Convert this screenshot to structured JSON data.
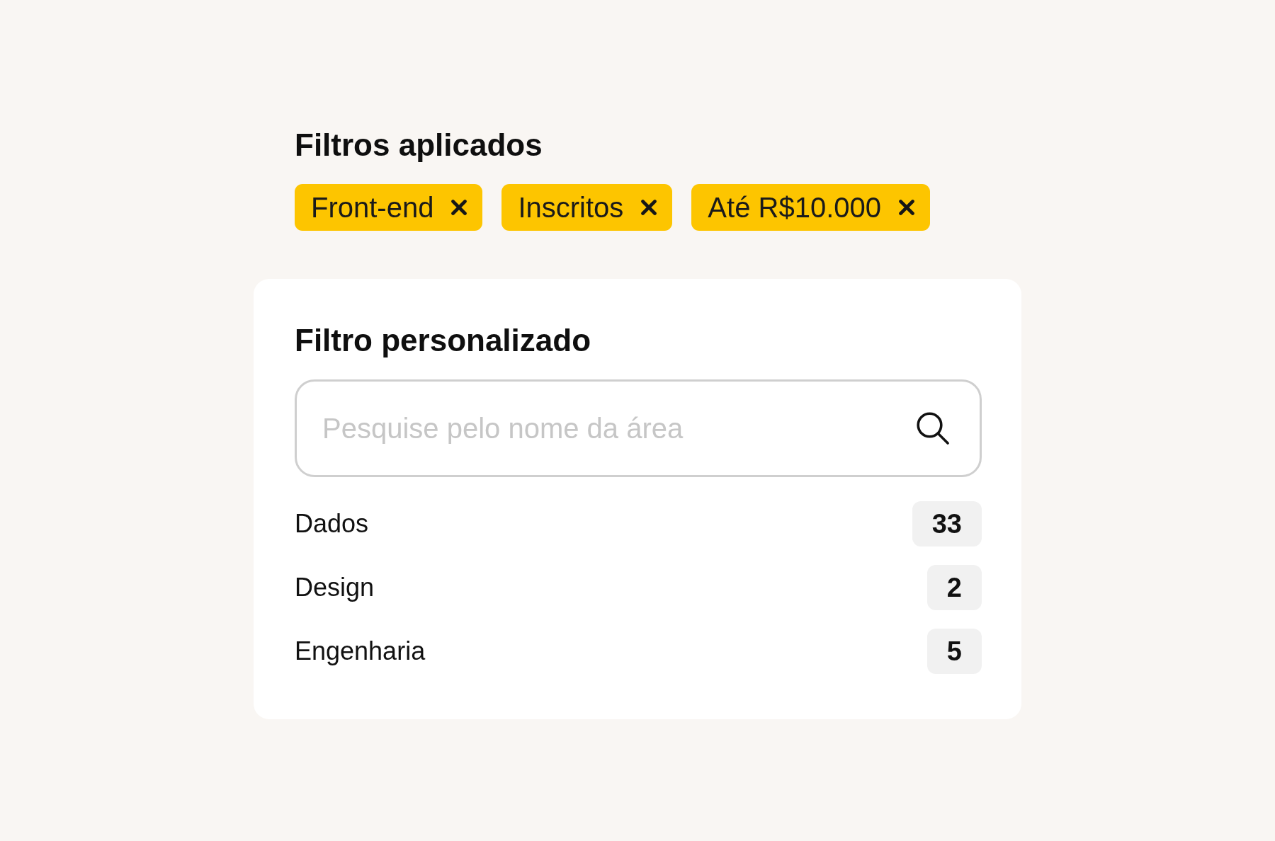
{
  "applied_filters": {
    "title": "Filtros aplicados",
    "chips": [
      {
        "label": "Front-end"
      },
      {
        "label": "Inscritos"
      },
      {
        "label": "Até R$10.000"
      }
    ]
  },
  "custom_filter": {
    "title": "Filtro personalizado",
    "search": {
      "placeholder": "Pesquise pelo nome da área"
    },
    "areas": [
      {
        "name": "Dados",
        "count": "33"
      },
      {
        "name": "Design",
        "count": "2"
      },
      {
        "name": "Engenharia",
        "count": "5"
      }
    ]
  }
}
